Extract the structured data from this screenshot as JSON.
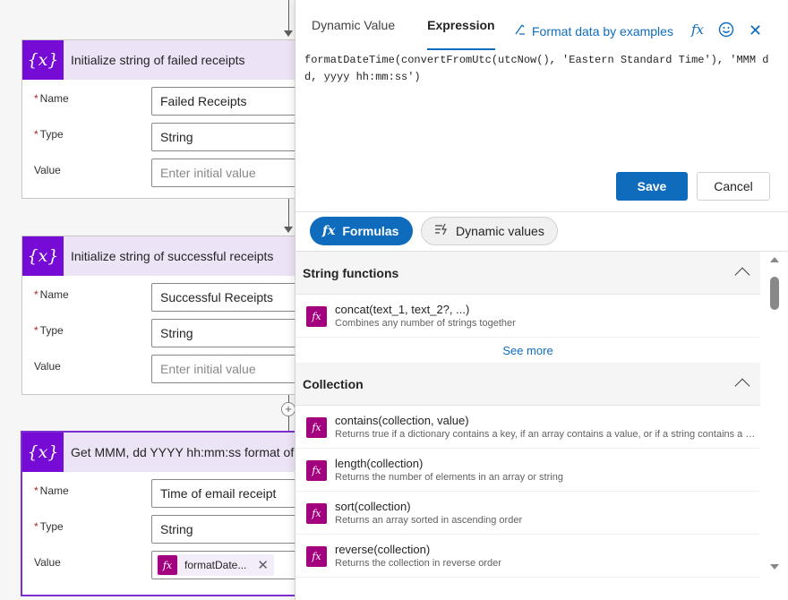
{
  "flow": {
    "cards": [
      {
        "title": "Initialize string of failed receipts",
        "icon": "variable-icon",
        "icon_glyph": "{x}",
        "fields": [
          {
            "label": "Name",
            "required": true,
            "value": "Failed Receipts",
            "placeholder": ""
          },
          {
            "label": "Type",
            "required": true,
            "value": "String",
            "placeholder": ""
          },
          {
            "label": "Value",
            "required": false,
            "value": "",
            "placeholder": "Enter initial value"
          }
        ]
      },
      {
        "title": "Initialize string of successful receipts",
        "icon": "variable-icon",
        "icon_glyph": "{x}",
        "fields": [
          {
            "label": "Name",
            "required": true,
            "value": "Successful Receipts",
            "placeholder": ""
          },
          {
            "label": "Type",
            "required": true,
            "value": "String",
            "placeholder": ""
          },
          {
            "label": "Value",
            "required": false,
            "value": "",
            "placeholder": "Enter initial value"
          }
        ]
      },
      {
        "title": "Get MMM, dd YYYY hh:mm:ss format of",
        "icon": "variable-icon",
        "icon_glyph": "{x}",
        "selected": true,
        "fields": [
          {
            "label": "Name",
            "required": true,
            "value": "Time of email receipt",
            "placeholder": ""
          },
          {
            "label": "Type",
            "required": true,
            "value": "String",
            "placeholder": ""
          },
          {
            "label": "Value",
            "required": false,
            "token": {
              "icon_glyph": "fx",
              "text": "formatDate..."
            }
          }
        ]
      }
    ],
    "required_marker": "*",
    "add_step_glyph": "+"
  },
  "panel": {
    "tabs": [
      {
        "label": "Dynamic Value",
        "active": false
      },
      {
        "label": "Expression",
        "active": true
      }
    ],
    "format_link": "Format data by examples",
    "fx_glyph": "fx",
    "close_glyph": "✕",
    "expression": "formatDateTime(convertFromUtc(utcNow(), 'Eastern Standard Time'), 'MMM dd, yyyy hh:mm:ss')",
    "save_label": "Save",
    "cancel_label": "Cancel",
    "pills": {
      "formulas": {
        "label": "Formulas",
        "glyph": "fx",
        "active": true
      },
      "dynamic": {
        "label": "Dynamic values",
        "glyph": "⚡",
        "active": false
      }
    },
    "sections": [
      {
        "title": "String functions",
        "expanded": true,
        "items": [
          {
            "name": "concat(text_1, text_2?, ...)",
            "desc": "Combines any number of strings together"
          }
        ],
        "see_more": "See more"
      },
      {
        "title": "Collection",
        "expanded": true,
        "items": [
          {
            "name": "contains(collection, value)",
            "desc": "Returns true if a dictionary contains a key, if an array contains a value, or if a string contains a substring"
          },
          {
            "name": "length(collection)",
            "desc": "Returns the number of elements in an array or string"
          },
          {
            "name": "sort(collection)",
            "desc": "Returns an array sorted in ascending order"
          },
          {
            "name": "reverse(collection)",
            "desc": "Returns the collection in reverse order"
          }
        ]
      }
    ],
    "fn_icon_glyph": "fx"
  },
  "colors": {
    "accent": "#0f6cbd",
    "variable_action": "#770bd6",
    "expression_token": "#a30080",
    "selected_border": "#7b2fcf"
  }
}
